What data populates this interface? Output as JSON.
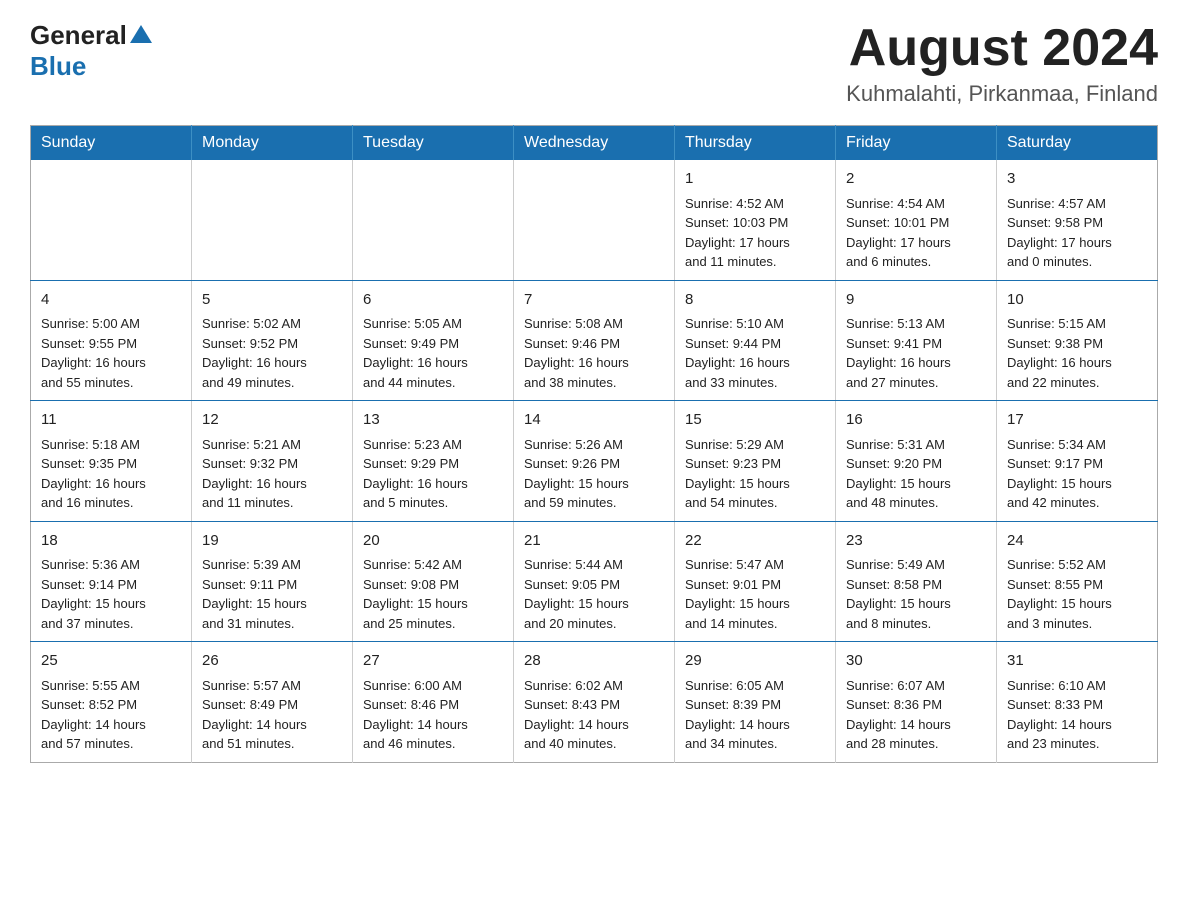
{
  "header": {
    "logo_general": "General",
    "logo_blue": "Blue",
    "title": "August 2024",
    "location": "Kuhmalahti, Pirkanmaa, Finland"
  },
  "calendar": {
    "days_of_week": [
      "Sunday",
      "Monday",
      "Tuesday",
      "Wednesday",
      "Thursday",
      "Friday",
      "Saturday"
    ],
    "weeks": [
      [
        {
          "day": "",
          "info": ""
        },
        {
          "day": "",
          "info": ""
        },
        {
          "day": "",
          "info": ""
        },
        {
          "day": "",
          "info": ""
        },
        {
          "day": "1",
          "info": "Sunrise: 4:52 AM\nSunset: 10:03 PM\nDaylight: 17 hours\nand 11 minutes."
        },
        {
          "day": "2",
          "info": "Sunrise: 4:54 AM\nSunset: 10:01 PM\nDaylight: 17 hours\nand 6 minutes."
        },
        {
          "day": "3",
          "info": "Sunrise: 4:57 AM\nSunset: 9:58 PM\nDaylight: 17 hours\nand 0 minutes."
        }
      ],
      [
        {
          "day": "4",
          "info": "Sunrise: 5:00 AM\nSunset: 9:55 PM\nDaylight: 16 hours\nand 55 minutes."
        },
        {
          "day": "5",
          "info": "Sunrise: 5:02 AM\nSunset: 9:52 PM\nDaylight: 16 hours\nand 49 minutes."
        },
        {
          "day": "6",
          "info": "Sunrise: 5:05 AM\nSunset: 9:49 PM\nDaylight: 16 hours\nand 44 minutes."
        },
        {
          "day": "7",
          "info": "Sunrise: 5:08 AM\nSunset: 9:46 PM\nDaylight: 16 hours\nand 38 minutes."
        },
        {
          "day": "8",
          "info": "Sunrise: 5:10 AM\nSunset: 9:44 PM\nDaylight: 16 hours\nand 33 minutes."
        },
        {
          "day": "9",
          "info": "Sunrise: 5:13 AM\nSunset: 9:41 PM\nDaylight: 16 hours\nand 27 minutes."
        },
        {
          "day": "10",
          "info": "Sunrise: 5:15 AM\nSunset: 9:38 PM\nDaylight: 16 hours\nand 22 minutes."
        }
      ],
      [
        {
          "day": "11",
          "info": "Sunrise: 5:18 AM\nSunset: 9:35 PM\nDaylight: 16 hours\nand 16 minutes."
        },
        {
          "day": "12",
          "info": "Sunrise: 5:21 AM\nSunset: 9:32 PM\nDaylight: 16 hours\nand 11 minutes."
        },
        {
          "day": "13",
          "info": "Sunrise: 5:23 AM\nSunset: 9:29 PM\nDaylight: 16 hours\nand 5 minutes."
        },
        {
          "day": "14",
          "info": "Sunrise: 5:26 AM\nSunset: 9:26 PM\nDaylight: 15 hours\nand 59 minutes."
        },
        {
          "day": "15",
          "info": "Sunrise: 5:29 AM\nSunset: 9:23 PM\nDaylight: 15 hours\nand 54 minutes."
        },
        {
          "day": "16",
          "info": "Sunrise: 5:31 AM\nSunset: 9:20 PM\nDaylight: 15 hours\nand 48 minutes."
        },
        {
          "day": "17",
          "info": "Sunrise: 5:34 AM\nSunset: 9:17 PM\nDaylight: 15 hours\nand 42 minutes."
        }
      ],
      [
        {
          "day": "18",
          "info": "Sunrise: 5:36 AM\nSunset: 9:14 PM\nDaylight: 15 hours\nand 37 minutes."
        },
        {
          "day": "19",
          "info": "Sunrise: 5:39 AM\nSunset: 9:11 PM\nDaylight: 15 hours\nand 31 minutes."
        },
        {
          "day": "20",
          "info": "Sunrise: 5:42 AM\nSunset: 9:08 PM\nDaylight: 15 hours\nand 25 minutes."
        },
        {
          "day": "21",
          "info": "Sunrise: 5:44 AM\nSunset: 9:05 PM\nDaylight: 15 hours\nand 20 minutes."
        },
        {
          "day": "22",
          "info": "Sunrise: 5:47 AM\nSunset: 9:01 PM\nDaylight: 15 hours\nand 14 minutes."
        },
        {
          "day": "23",
          "info": "Sunrise: 5:49 AM\nSunset: 8:58 PM\nDaylight: 15 hours\nand 8 minutes."
        },
        {
          "day": "24",
          "info": "Sunrise: 5:52 AM\nSunset: 8:55 PM\nDaylight: 15 hours\nand 3 minutes."
        }
      ],
      [
        {
          "day": "25",
          "info": "Sunrise: 5:55 AM\nSunset: 8:52 PM\nDaylight: 14 hours\nand 57 minutes."
        },
        {
          "day": "26",
          "info": "Sunrise: 5:57 AM\nSunset: 8:49 PM\nDaylight: 14 hours\nand 51 minutes."
        },
        {
          "day": "27",
          "info": "Sunrise: 6:00 AM\nSunset: 8:46 PM\nDaylight: 14 hours\nand 46 minutes."
        },
        {
          "day": "28",
          "info": "Sunrise: 6:02 AM\nSunset: 8:43 PM\nDaylight: 14 hours\nand 40 minutes."
        },
        {
          "day": "29",
          "info": "Sunrise: 6:05 AM\nSunset: 8:39 PM\nDaylight: 14 hours\nand 34 minutes."
        },
        {
          "day": "30",
          "info": "Sunrise: 6:07 AM\nSunset: 8:36 PM\nDaylight: 14 hours\nand 28 minutes."
        },
        {
          "day": "31",
          "info": "Sunrise: 6:10 AM\nSunset: 8:33 PM\nDaylight: 14 hours\nand 23 minutes."
        }
      ]
    ]
  }
}
